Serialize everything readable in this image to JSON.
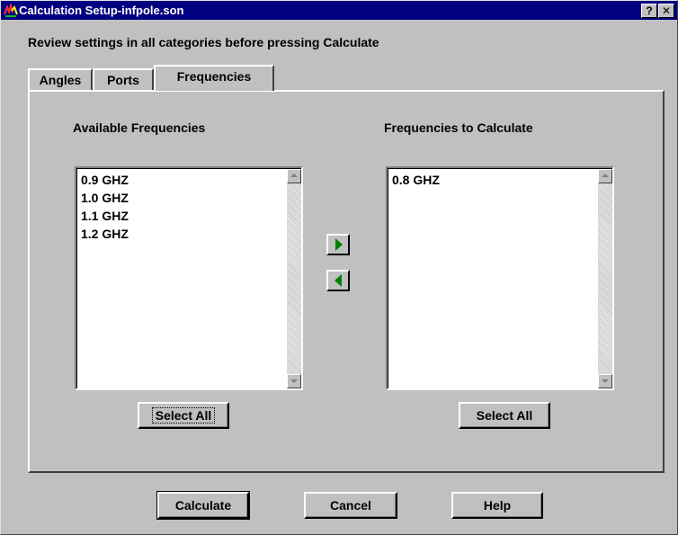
{
  "window": {
    "title": "Calculation Setup-infpole.son",
    "help_button": "?",
    "close_button": "✕"
  },
  "instruction": "Review settings in all categories before pressing Calculate",
  "tabs": [
    {
      "label": "Angles"
    },
    {
      "label": "Ports"
    },
    {
      "label": "Frequencies"
    }
  ],
  "frequencies_tab": {
    "available_label": "Available Frequencies",
    "selected_label": "Frequencies to Calculate",
    "available": [
      "0.9 GHZ",
      "1.0 GHZ",
      "1.1 GHZ",
      "1.2 GHZ"
    ],
    "selected": [
      "0.8 GHZ"
    ],
    "select_all_available": "Select All",
    "select_all_selected": "Select All"
  },
  "buttons": {
    "calculate": "Calculate",
    "cancel": "Cancel",
    "help": "Help"
  },
  "colors": {
    "titlebar": "#000080",
    "face": "#c0c0c0",
    "arrow": "#008000"
  }
}
